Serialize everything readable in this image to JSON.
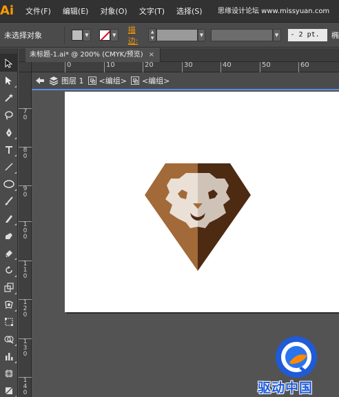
{
  "app": {
    "logo": "Ai",
    "menu": [
      "文件(F)",
      "编辑(E)",
      "对象(O)",
      "文字(T)",
      "选择(S)"
    ],
    "watermark_top": "思缘设计论坛 www.missyuan.com"
  },
  "control_bar": {
    "selection_label": "未选择对象",
    "stroke_label": "描边:",
    "stroke_weight": "2 pt.",
    "profile_label": "椭",
    "fill_color": "#bdbdbd",
    "stroke_color": "none"
  },
  "document": {
    "tab_title": "未标题-1.ai* @ 200% (CMYK/预览)",
    "close_glyph": "×"
  },
  "ruler": {
    "top_ticks": [
      "0",
      "10",
      "20",
      "30",
      "40",
      "50",
      "60"
    ],
    "left_ticks": [
      "7\n0",
      "8\n0",
      "9\n0",
      "1\n0\n0",
      "1\n1\n0",
      "1\n2\n0",
      "1\n3\n0",
      "1\n4\n0"
    ]
  },
  "isolation": {
    "layer_label": "图层 1",
    "group_label_1": "<编组>",
    "group_label_2": "<编组>"
  },
  "artwork": {
    "icon_name": "lion-diamond-icon",
    "colors": {
      "left_facet": "#a26a38",
      "right_facet": "#4d2a12",
      "face_left": "#eae0d5",
      "face_right": "#cfc3b8"
    }
  },
  "tools": [
    "selection-tool-icon",
    "direct-selection-tool-icon",
    "magic-wand-icon",
    "lasso-icon",
    "pen-tool-icon",
    "type-tool-icon",
    "line-tool-icon",
    "ellipse-tool-icon",
    "paintbrush-icon",
    "pencil-icon",
    "blob-brush-icon",
    "eraser-icon",
    "rotate-tool-icon",
    "scale-tool-icon",
    "warp-tool-icon",
    "free-transform-icon",
    "shape-builder-icon",
    "graph-tool-icon",
    "artboard-tool-icon",
    "slice-tool-icon"
  ],
  "watermark_bottom": {
    "text": "驱动中国"
  }
}
